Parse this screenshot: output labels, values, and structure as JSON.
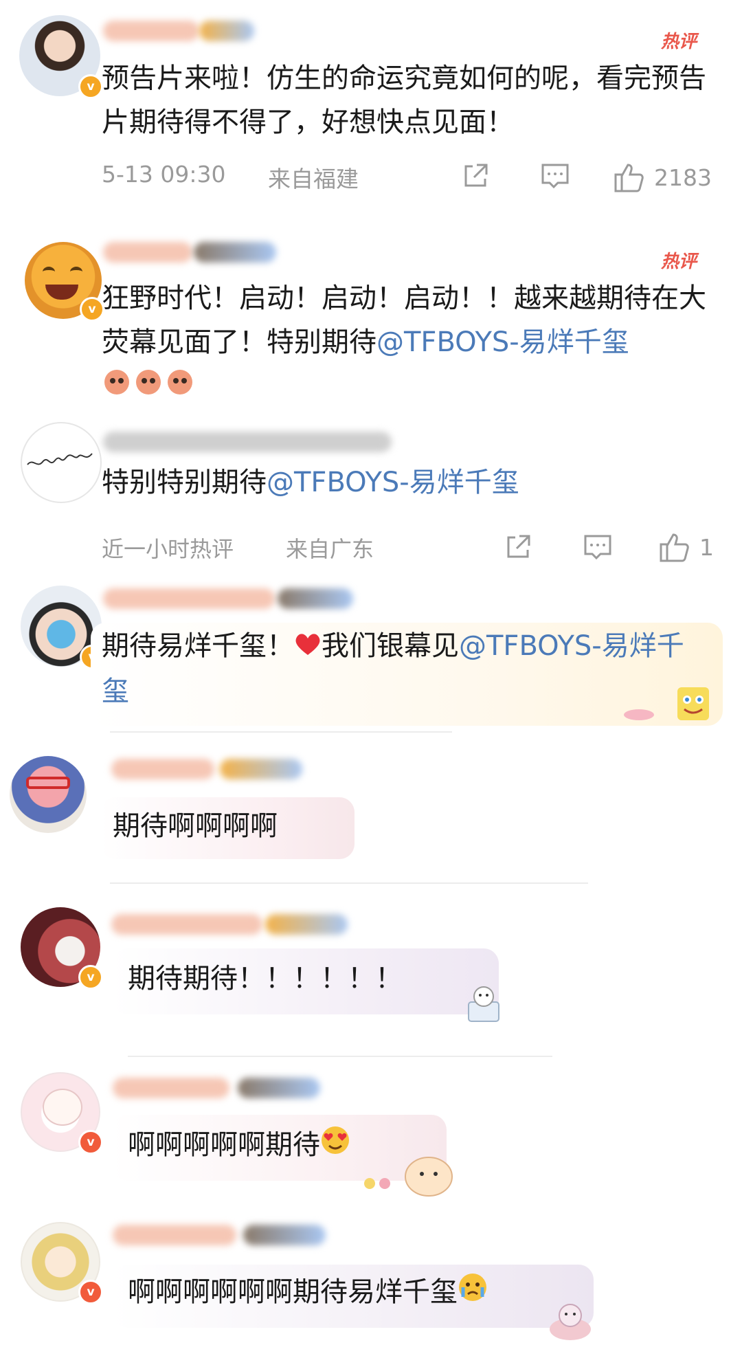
{
  "comments": [
    {
      "text": "预告片来啦！仿生的命运究竟如何的呢，看完预告片期待得不得了，好想快点见面！",
      "hot_label": "热评",
      "time": "5-13 09:30",
      "location": "来自福建",
      "likes": "2183"
    },
    {
      "text_main": "狂野时代！启动！启动！启动！！越来越期待在大荧幕见面了！特别期待",
      "mention": "@TFBOYS-易烊千玺",
      "hot_label": "热评"
    },
    {
      "text_main": "特别特别期待",
      "mention": "@TFBOYS-易烊千玺",
      "time": "近一小时热评",
      "location": "来自广东",
      "likes": "1"
    },
    {
      "text_main": "期待易烊千玺！",
      "text_after_heart": "我们银幕见",
      "mention": "@TFBOYS-易烊千玺"
    },
    {
      "text": "期待啊啊啊啊"
    },
    {
      "text": "期待期待！！！！！！"
    },
    {
      "text": "啊啊啊啊啊期待"
    },
    {
      "text": "啊啊啊啊啊啊期待易烊千玺"
    }
  ],
  "colors": {
    "mention": "#4b7ab8",
    "hot": "#e9574b",
    "meta": "#9a9a9a",
    "badge_gold": "#f5a623",
    "badge_red": "#f15b3b"
  },
  "icons": [
    "share-icon",
    "comment-icon",
    "like-icon",
    "verified-badge-icon",
    "heart-icon"
  ]
}
